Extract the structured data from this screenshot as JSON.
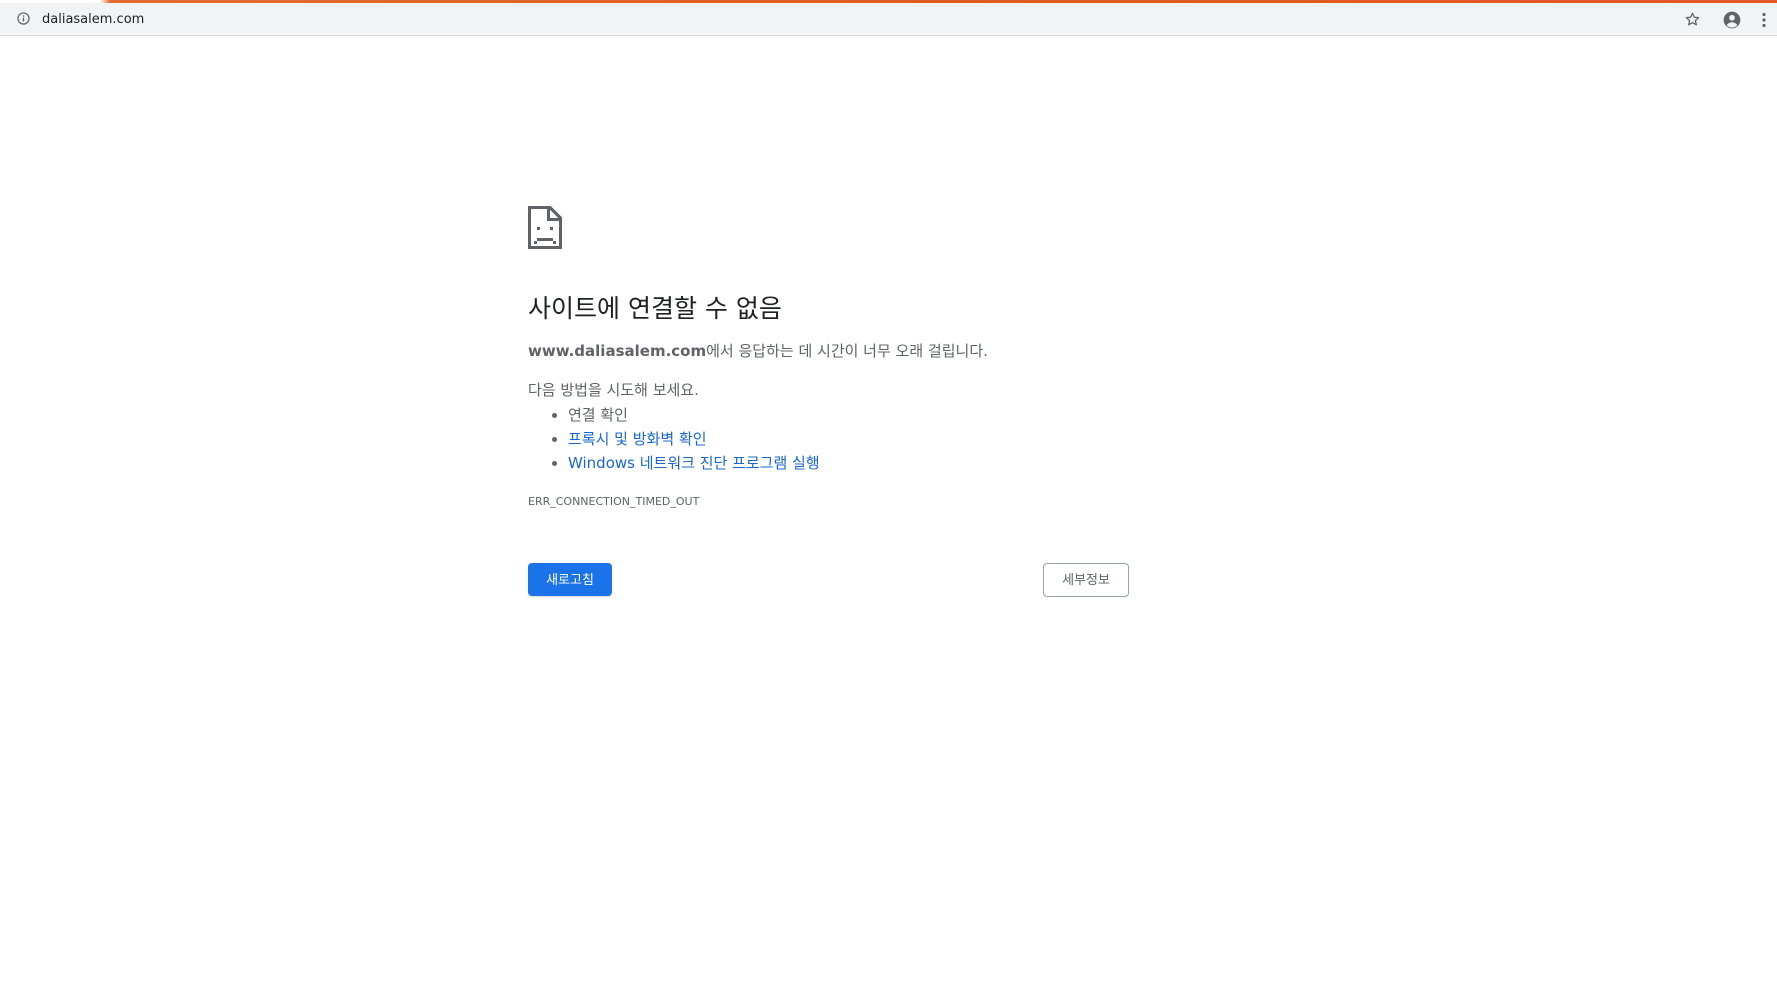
{
  "browser": {
    "url": "daliasalem.com",
    "icons": {
      "site_info": "info-icon",
      "bookmark": "star-icon",
      "profile": "account-circle-icon",
      "menu": "vertical-dots-icon"
    }
  },
  "error_page": {
    "icon": "sad-page-icon",
    "heading": "사이트에 연결할 수 없음",
    "domain": "www.daliasalem.com",
    "description_suffix": "에서 응답하는 데 시간이 너무 오래 걸립니다.",
    "try_label": "다음 방법을 시도해 보세요.",
    "suggestions": [
      {
        "text": "연결 확인",
        "link": false
      },
      {
        "text": "프록시 및 방화벽 확인",
        "link": true
      },
      {
        "text": "Windows 네트워크 진단 프로그램 실행",
        "link": true
      }
    ],
    "error_code": "ERR_CONNECTION_TIMED_OUT",
    "reload_label": "새로고침",
    "details_label": "세부정보"
  },
  "colors": {
    "accent": "#1a73e8",
    "link": "#1967d2",
    "loading_stripe": "#e05a1f",
    "toolbar_bg": "#f1f3f4"
  }
}
